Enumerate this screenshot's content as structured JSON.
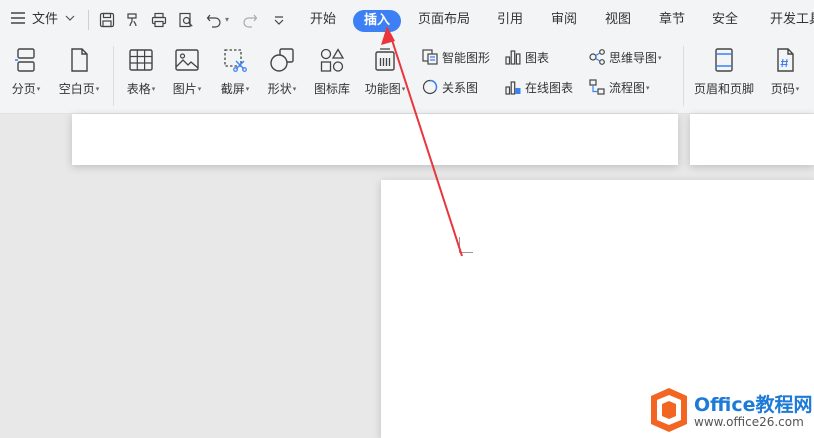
{
  "menubar": {
    "file_label": "文件",
    "tabs": [
      "开始",
      "插入",
      "页面布局",
      "引用",
      "审阅",
      "视图",
      "章节",
      "安全",
      "开发工具"
    ],
    "active_tab": "插入",
    "accent": "#3d7ff5"
  },
  "ribbon": {
    "page_break": "分页",
    "blank_page": "空白页",
    "table": "表格",
    "picture": "图片",
    "screenshot": "截屏",
    "shape": "形状",
    "icon_library": "图标库",
    "function_chart": "功能图",
    "smart_graphic": "智能图形",
    "chart": "图表",
    "mind_map": "思维导图",
    "relation_chart": "关系图",
    "online_chart": "在线图表",
    "flowchart": "流程图",
    "header_footer": "页眉和页脚",
    "page_number": "页码"
  },
  "annotation": {
    "arrow_color": "#e8363c"
  },
  "watermark": {
    "title": "Office教程网",
    "url": "www.office26.com",
    "logo_color": "#f26522"
  }
}
